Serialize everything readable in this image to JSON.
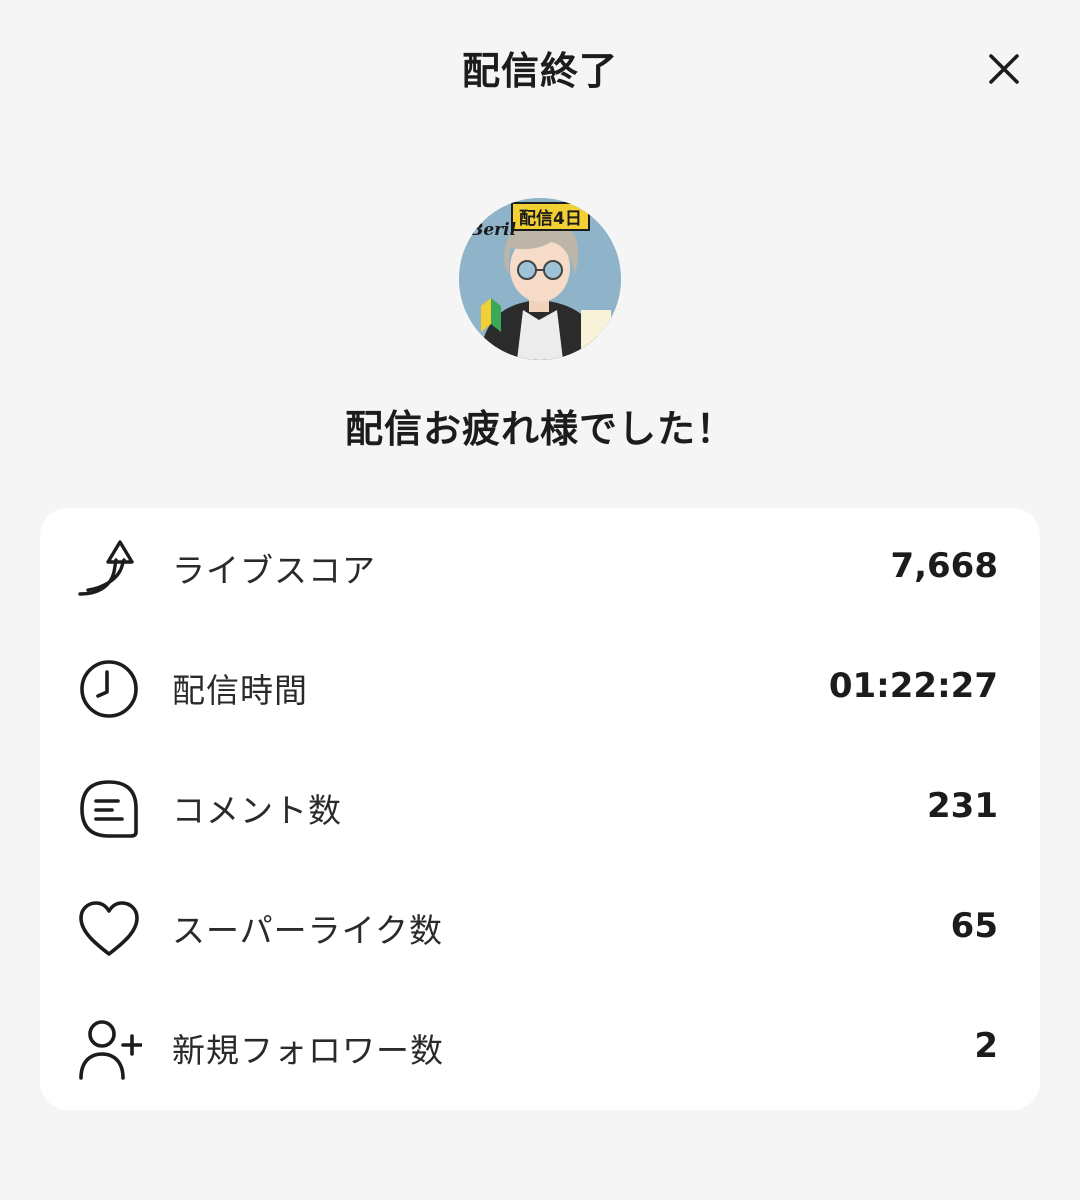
{
  "header": {
    "title": "配信終了",
    "close_icon": "close-icon"
  },
  "avatar": {
    "banner_text": "配信4日",
    "name_text": "Beril"
  },
  "message": "配信お疲れ様でした！",
  "stats": [
    {
      "icon": "trending-up-arrow-icon",
      "label": "ライブスコア",
      "value": "7,668"
    },
    {
      "icon": "clock-icon",
      "label": "配信時間",
      "value": "01:22:27"
    },
    {
      "icon": "comment-icon",
      "label": "コメント数",
      "value": "231"
    },
    {
      "icon": "heart-icon",
      "label": "スーパーライク数",
      "value": "65"
    },
    {
      "icon": "add-user-icon",
      "label": "新規フォロワー数",
      "value": "2"
    }
  ],
  "colors": {
    "background": "#f5f5f5",
    "card": "#ffffff",
    "text": "#1c1c1c"
  }
}
